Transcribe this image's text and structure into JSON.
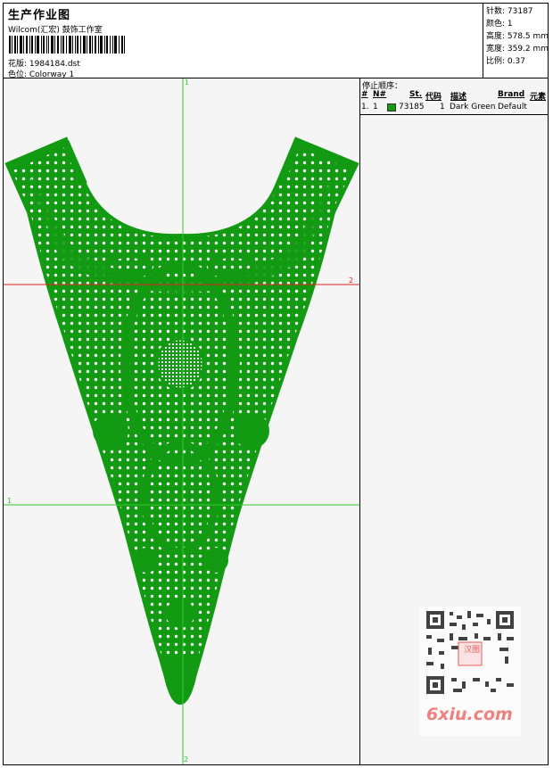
{
  "header": {
    "title": "生产作业图",
    "company": "Wilcom(汇宏) 鼓饰工作室",
    "design_label": "花版: 1984184.dst",
    "colorway_label": "色位: Colorway 1"
  },
  "stats": {
    "stitches": "针数: 73187",
    "colors": "颜色: 1",
    "height": "高度: 578.5 mm",
    "width": "宽度: 359.2 mm",
    "scale": "比例: 0.37"
  },
  "canvas": {
    "axis_top_label": "1",
    "axis_right_label": "2",
    "axis_left_label": "1",
    "axis_bottom_label": "2",
    "design_color": "#139a13",
    "vertical_axis_color": "#2fc92f",
    "horizontal_axis_color": "#e02020",
    "lower_axis_color": "#2fc92f"
  },
  "stop_sequence": {
    "title": "停止顺序：",
    "columns": [
      "#",
      "N#",
      "St.",
      "代码",
      "描述",
      "Brand",
      "元素"
    ],
    "rows": [
      {
        "index": "1.",
        "needle": "1",
        "color": "#119d11",
        "stitches": "73185",
        "code": "1",
        "description": "Dark Green",
        "brand": "Default"
      }
    ]
  },
  "watermark": {
    "text": "6xiu.com",
    "badge_text": "汉图"
  }
}
